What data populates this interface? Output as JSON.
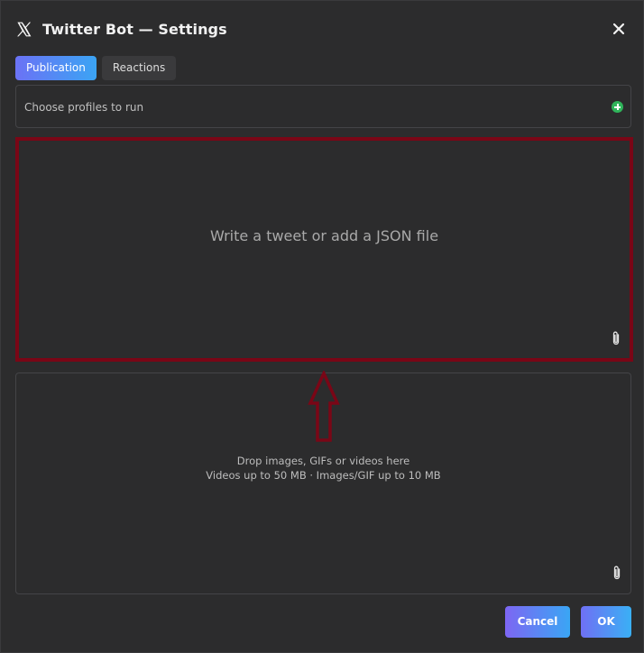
{
  "window": {
    "title": "Twitter Bot — Settings",
    "logo_icon": "x-logo-icon",
    "close_icon": "close-icon"
  },
  "tabs": [
    {
      "label": "Publication",
      "active": true
    },
    {
      "label": "Reactions",
      "active": false
    }
  ],
  "profiles": {
    "label": "Choose profiles to run",
    "add_icon": "plus-circle-icon",
    "add_color": "#2fb45a"
  },
  "tweet": {
    "placeholder": "Write a tweet or add a JSON file",
    "attach_icon": "paperclip-icon",
    "highlight_color": "#7a0616"
  },
  "media": {
    "line1": "Drop images, GIFs or videos here",
    "line2": "Videos up to 50 MB · Images/GIF up to 10 MB",
    "attach_icon": "paperclip-icon"
  },
  "annotation": {
    "arrow_icon": "up-arrow-outline-icon",
    "color": "#7a0616"
  },
  "footer": {
    "cancel_label": "Cancel",
    "ok_label": "OK"
  },
  "colors": {
    "background": "#2c2c2d",
    "accent_start": "#6b72f5",
    "accent_end": "#3ba4f4"
  }
}
